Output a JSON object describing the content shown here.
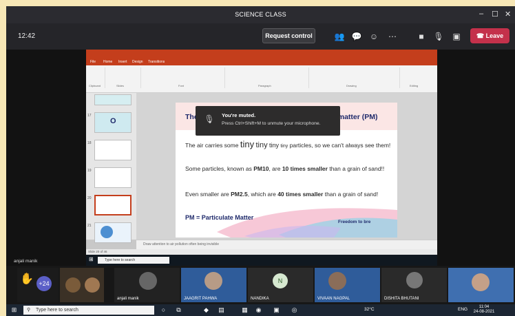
{
  "window": {
    "title": "SCIENCE CLASS"
  },
  "toolbar": {
    "time": "12:42",
    "request_control": "Request control",
    "leave": "Leave"
  },
  "toast": {
    "title": "You're muted.",
    "message": "Press Ctrl+Shift+M to unmute your microphone."
  },
  "powerpoint": {
    "tabs": [
      "File",
      "Home",
      "Insert",
      "Design",
      "Transitions"
    ],
    "groups": [
      "Clipboard",
      "Slides",
      "Font",
      "Paragraph",
      "Drawing",
      "Editing"
    ],
    "thumbnails": [
      "17",
      "18",
      "19",
      "20",
      "21"
    ],
    "notes": "Draw attention to air pollution often being invisible",
    "status": "Slide 20 of 46"
  },
  "slide": {
    "title": "The particles in the air are called particulate matter (PM)",
    "para1_a": "The air carries some ",
    "tiny_words": [
      "tiny",
      "tiny",
      "tiny",
      "tiny"
    ],
    "para1_b": " particles, so we can't always see them!",
    "para2_a": "Some particles, known as ",
    "para2_b": "PM10",
    "para2_c": ", are ",
    "para2_d": "10 times smaller",
    "para2_e": " than a grain of sand!!",
    "para3_a": "Even smaller are ",
    "para3_b": "PM2.5",
    "para3_c": ", which are ",
    "para3_d": "40 times smaller",
    "para3_e": " than a grain of sand!",
    "pm_label": "PM = Particulate Matter",
    "brand": "Freedom to bre"
  },
  "inner_taskbar": {
    "search": "Type here to search"
  },
  "presenter": "anjali manik",
  "participants": [
    {
      "name": "",
      "label": "+24"
    },
    {
      "name": "anjali manik",
      "label": ""
    },
    {
      "name": "JAAGRIT PAHWA",
      "label": ""
    },
    {
      "name": "NANDIKA",
      "label": "N"
    },
    {
      "name": "VIVAAN NAGPAL",
      "label": ""
    },
    {
      "name": "DISHITA BHUTANI",
      "label": ""
    },
    {
      "name": "",
      "label": ""
    }
  ],
  "taskbar": {
    "search": "Type here to search",
    "temp": "32°C",
    "lang": "ENG",
    "time": "11:04",
    "date": "24-08-2021"
  }
}
